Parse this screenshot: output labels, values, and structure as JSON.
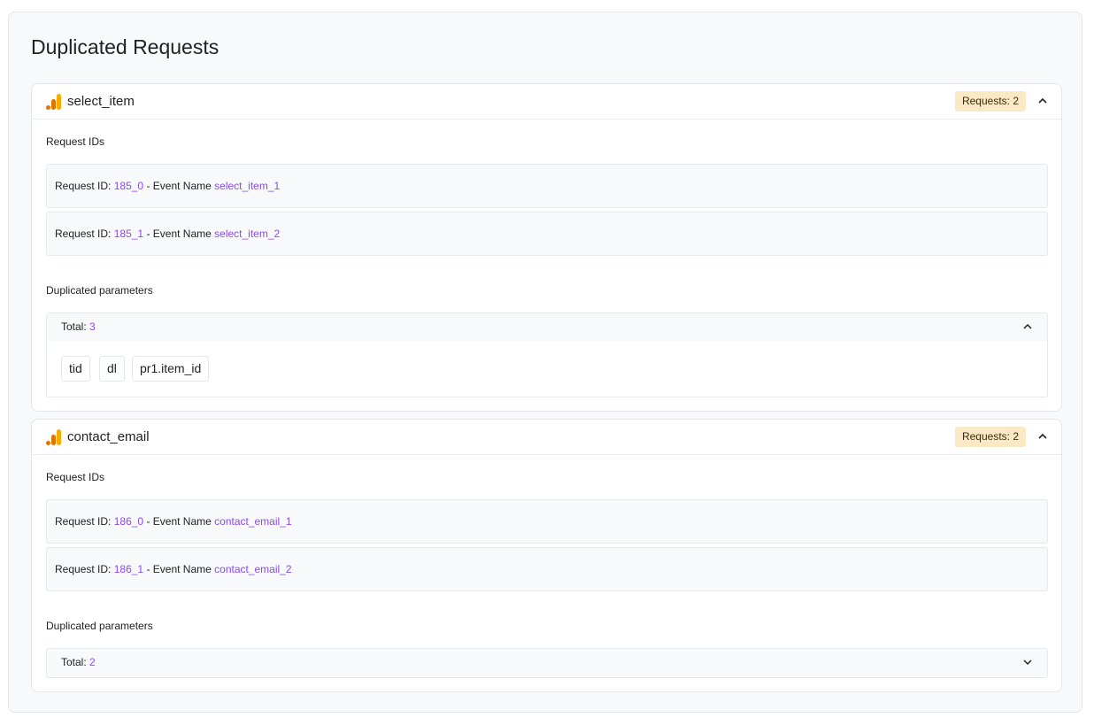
{
  "page": {
    "title": "Duplicated Requests"
  },
  "events": [
    {
      "icon": "google-analytics-icon",
      "title": "select_item",
      "badge": "Requests: 2",
      "request_ids_label": "Request IDs",
      "requests": [
        {
          "prefix": "Request ID:",
          "id": "185_0",
          "sep": "- Event Name",
          "event": "select_item_1"
        },
        {
          "prefix": "Request ID:",
          "id": "185_1",
          "sep": "- Event Name",
          "event": "select_item_2"
        }
      ],
      "dup_label": "Duplicated parameters",
      "total_label": "Total:",
      "total": "3",
      "expanded": true,
      "params": [
        "tid",
        "dl",
        "pr1.item_id"
      ]
    },
    {
      "icon": "google-analytics-icon",
      "title": "contact_email",
      "badge": "Requests: 2",
      "request_ids_label": "Request IDs",
      "requests": [
        {
          "prefix": "Request ID:",
          "id": "186_0",
          "sep": "- Event Name",
          "event": "contact_email_1"
        },
        {
          "prefix": "Request ID:",
          "id": "186_1",
          "sep": "- Event Name",
          "event": "contact_email_2"
        }
      ],
      "dup_label": "Duplicated parameters",
      "total_label": "Total:",
      "total": "2",
      "expanded": false,
      "params": []
    }
  ],
  "colors": {
    "accent": "#8a4af3",
    "badge_bg": "#fbe8c4",
    "ga_orange": "#f9ab00",
    "ga_dark_orange": "#e37400"
  }
}
